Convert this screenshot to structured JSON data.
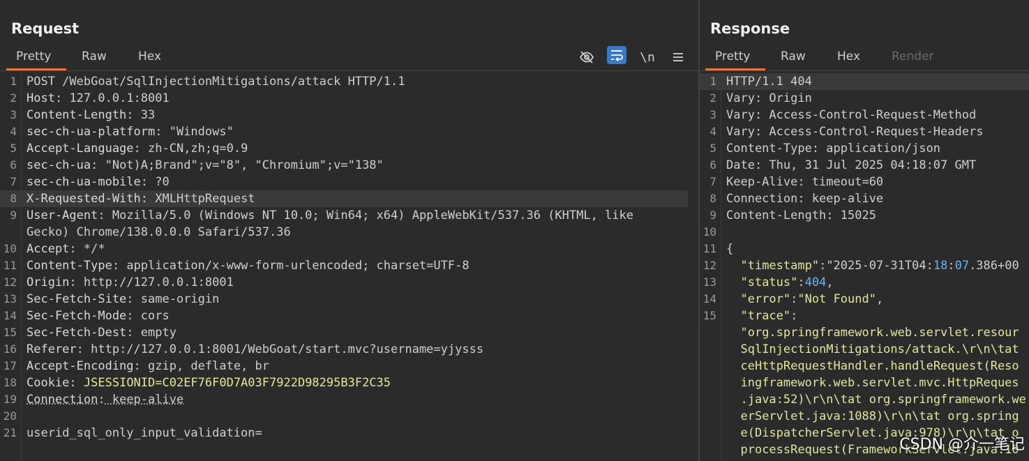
{
  "request": {
    "title": "Request",
    "tabs": [
      "Pretty",
      "Raw",
      "Hex"
    ],
    "active_tab": "Pretty",
    "tools": {
      "newline_label": "\\n"
    },
    "lines": [
      {
        "n": "1",
        "k": "POST /WebGoat/SqlInjectionMitigations/attack HTTP/1.1",
        "v": ""
      },
      {
        "n": "2",
        "k": "Host",
        "v": " 127.0.0.1:8001"
      },
      {
        "n": "3",
        "k": "Content-Length",
        "v": " 33"
      },
      {
        "n": "4",
        "k": "sec-ch-ua-platform",
        "v": " \"Windows\""
      },
      {
        "n": "5",
        "k": "Accept-Language",
        "v": " zh-CN,zh;q=0.9"
      },
      {
        "n": "6",
        "k": "sec-ch-ua",
        "v": " \"Not)A;Brand\";v=\"8\", \"Chromium\";v=\"138\""
      },
      {
        "n": "7",
        "k": "sec-ch-ua-mobile",
        "v": " ?0"
      },
      {
        "n": "8",
        "k": "X-Requested-With",
        "v": " XMLHttpRequest"
      },
      {
        "n": "9",
        "k": "User-Agent",
        "v": " Mozilla/5.0 (Windows NT 10.0; Win64; x64) AppleWebKit/537.36 (KHTML, like"
      },
      {
        "n": "",
        "k": "",
        "v": "Gecko) Chrome/138.0.0.0 Safari/537.36"
      },
      {
        "n": "10",
        "k": "Accept",
        "v": " */*"
      },
      {
        "n": "11",
        "k": "Content-Type",
        "v": " application/x-www-form-urlencoded; charset=UTF-8"
      },
      {
        "n": "12",
        "k": "Origin",
        "v": " http://127.0.0.1:8001"
      },
      {
        "n": "13",
        "k": "Sec-Fetch-Site",
        "v": " same-origin"
      },
      {
        "n": "14",
        "k": "Sec-Fetch-Mode",
        "v": " cors"
      },
      {
        "n": "15",
        "k": "Sec-Fetch-Dest",
        "v": " empty"
      },
      {
        "n": "16",
        "k": "Referer",
        "v": " http://127.0.0.1:8001/WebGoat/start.mvc?username=yjysss"
      },
      {
        "n": "17",
        "k": "Accept-Encoding",
        "v": " gzip, deflate, br"
      },
      {
        "n": "18",
        "k": "Cookie",
        "v": " JSESSIONID=C02EF76F0D7A03F7922D98295B3F2C35"
      },
      {
        "n": "19",
        "k": "Connection",
        "v": " keep-alive"
      },
      {
        "n": "20",
        "k": "",
        "v": ""
      },
      {
        "n": "21",
        "k": "userid_sql_only_input_validation=",
        "v": ""
      }
    ]
  },
  "response": {
    "title": "Response",
    "tabs": [
      "Pretty",
      "Raw",
      "Hex",
      "Render"
    ],
    "active_tab": "Pretty",
    "lines": [
      {
        "n": "1",
        "t": "HTTP/1.1 404"
      },
      {
        "n": "2",
        "t": "Vary: Origin"
      },
      {
        "n": "3",
        "t": "Vary: Access-Control-Request-Method"
      },
      {
        "n": "4",
        "t": "Vary: Access-Control-Request-Headers"
      },
      {
        "n": "5",
        "t": "Content-Type: application/json"
      },
      {
        "n": "6",
        "t": "Date: Thu, 31 Jul 2025 04:18:07 GMT"
      },
      {
        "n": "7",
        "t": "Keep-Alive: timeout=60"
      },
      {
        "n": "8",
        "t": "Connection: keep-alive"
      },
      {
        "n": "9",
        "t": "Content-Length: 15025"
      },
      {
        "n": "10",
        "t": ""
      },
      {
        "n": "11",
        "t": "{"
      },
      {
        "n": "12",
        "t": "  \"timestamp\":\"2025-07-31T04:18:07.386+00"
      },
      {
        "n": "13",
        "t": "  \"status\":404,"
      },
      {
        "n": "14",
        "t": "  \"error\":\"Not Found\","
      },
      {
        "n": "15",
        "t": "  \"trace\":"
      },
      {
        "n": "",
        "t": "  \"org.springframework.web.servlet.resour"
      },
      {
        "n": "",
        "t": "  SqlInjectionMitigations/attack.\\r\\n\\tat"
      },
      {
        "n": "",
        "t": "  ceHttpRequestHandler.handleRequest(Reso"
      },
      {
        "n": "",
        "t": "  ingframework.web.servlet.mvc.HttpReques"
      },
      {
        "n": "",
        "t": "  .java:52)\\r\\n\\tat org.springframework.we"
      },
      {
        "n": "",
        "t": "  erServlet.java:1088)\\r\\n\\tat org.spring"
      },
      {
        "n": "",
        "t": "  e(DispatcherServlet.java:978)\\r\\n\\tat o"
      },
      {
        "n": "",
        "t": "  processRequest(FrameworkServlet.java:10"
      }
    ]
  },
  "watermark": "CSDN @介一笔记"
}
